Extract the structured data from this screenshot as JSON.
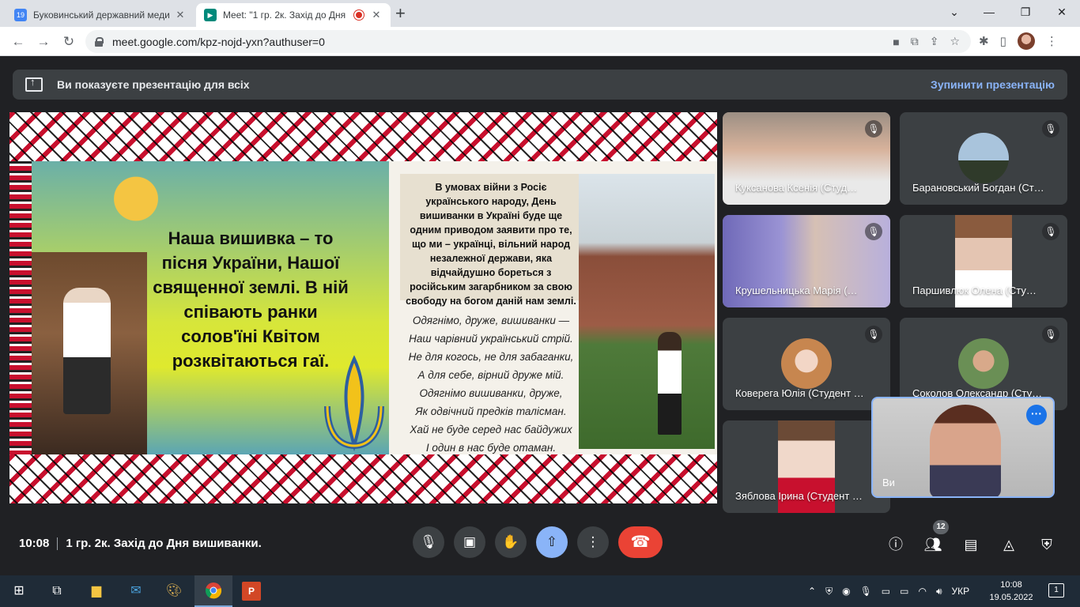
{
  "browser": {
    "tabs": [
      {
        "title": "Буковинський державний меди",
        "favicon_text": "19",
        "favicon_color": "#4285f4"
      },
      {
        "title": "Meet: \"1 гр. 2к. Захід до Дня",
        "favicon_text": "",
        "favicon_color": "#00897b"
      }
    ],
    "new_tab": "+",
    "url": "meet.google.com/kpz-nojd-yxn?authuser=0"
  },
  "banner": {
    "text": "Ви показуєте презентацію для всіх",
    "stop": "Зупинити презентацію"
  },
  "slide": {
    "left_text": "Наша вишивка – то пісня України, Нашої священної землі. В ній співають ранки солов'їні Квітом розквітаються гаї.",
    "mid_box": "В умовах війни з Росіє українського народу, День вишиванки в Україні буде ще одним приводом заявити про те, що ми – українці, вільний народ незалежної держави, яка відчайдушно бореться з російським загарбником за свою свободу на богом даній нам землі.",
    "poem": [
      "Одягнімо, друже, вишиванки —",
      "Наш чарівний український стрій.",
      "Не для когось, не для забаганки,",
      "А для себе, вірний друже мій.",
      "Одягнімо вишиванки, друже,",
      "Як одвічний предків талісман.",
      "Хай не буде серед нас байдужих",
      "І один в нас буде отаман."
    ]
  },
  "participants": [
    {
      "name": "Куксанова Ксенія (Студ…",
      "type": "video",
      "color": "#c9a58c"
    },
    {
      "name": "Барановський Богдан (Ст…",
      "type": "avatar",
      "color": "#5b7d98"
    },
    {
      "name": "Крушельницька Марія (…",
      "type": "video",
      "color": "#8c86c4"
    },
    {
      "name": "Паршивлюк Олена (Сту…",
      "type": "avatar",
      "color": "#c7b29e"
    },
    {
      "name": "Коверега Юлія (Студент …",
      "type": "avatar",
      "color": "#d9b28f"
    },
    {
      "name": "Соколов Олександр (Сту…",
      "type": "avatar",
      "color": "#7a8c63"
    },
    {
      "name": "Зяблова Ірина (Студент …",
      "type": "avatar",
      "color": "#d8c2b5"
    }
  ],
  "self_tile": {
    "name": "Ви"
  },
  "bottom": {
    "time": "10:08",
    "meeting_title": "1 гр. 2к. Захід до Дня вишиванки.",
    "participants_count": "12"
  },
  "taskbar": {
    "lang": "УКР",
    "time": "10:08",
    "date": "19.05.2022",
    "notifications": "1"
  }
}
